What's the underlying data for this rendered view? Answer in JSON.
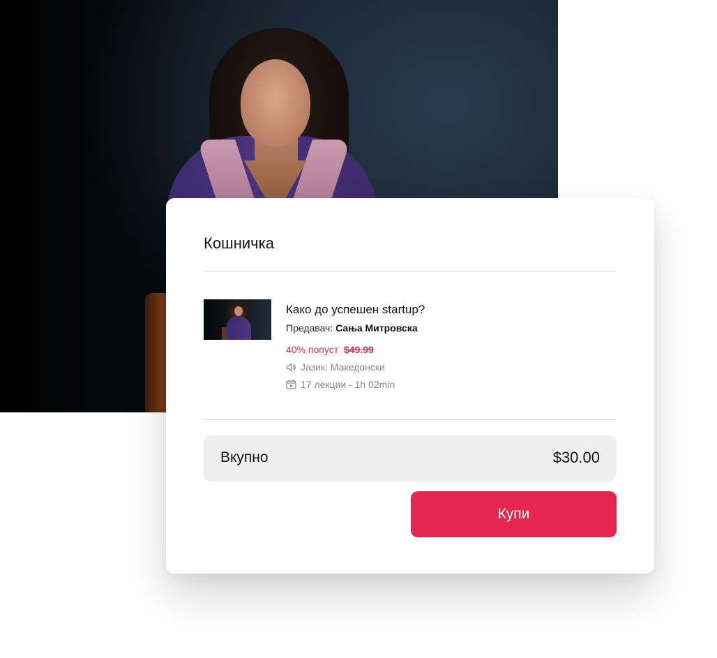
{
  "cart": {
    "title": "Кошничка",
    "item": {
      "title": "Како до успешен startup?",
      "instructor_label": "Предавач:",
      "instructor_name": "Сања Митровска",
      "discount_text": "40% попуст",
      "old_price": "$49.99",
      "language": "Јазик: Македонски",
      "language_icon": "speaker-icon",
      "lessons": "17 лекции - 1h 02min",
      "lessons_icon": "video-calendar-icon"
    },
    "total": {
      "label": "Вкупно",
      "value": "$30.00"
    },
    "buy_label": "Купи"
  },
  "colors": {
    "accent": "#e5264f",
    "discount": "#e5274f",
    "muted_text": "#8a8a8a",
    "total_bg": "#efefef"
  }
}
